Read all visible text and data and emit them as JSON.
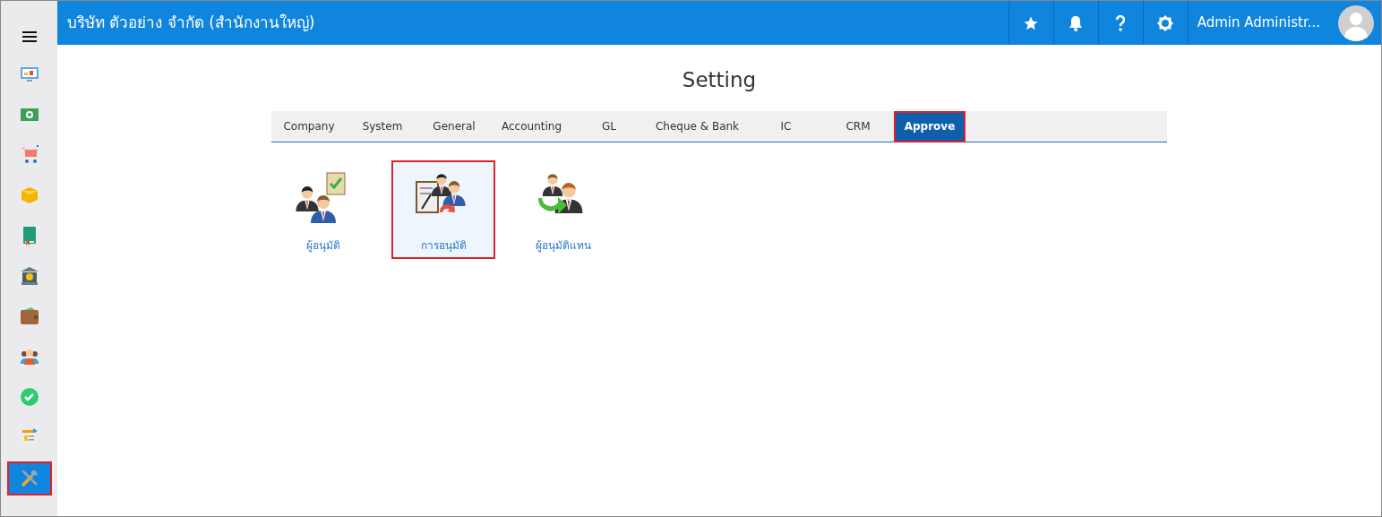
{
  "header": {
    "company": "บริษัท ตัวอย่าง จำกัด (สำนักงานใหญ่)",
    "user": "Admin Administr..."
  },
  "sidebar": {
    "items": [
      {
        "selected": false
      },
      {
        "selected": false
      },
      {
        "selected": false
      },
      {
        "selected": false
      },
      {
        "selected": false
      },
      {
        "selected": false
      },
      {
        "selected": false
      },
      {
        "selected": false
      },
      {
        "selected": false
      },
      {
        "selected": false
      },
      {
        "selected": true
      }
    ]
  },
  "page_title": "Setting",
  "tabs": [
    {
      "label": "Company",
      "selected": false
    },
    {
      "label": "System",
      "selected": false
    },
    {
      "label": "General",
      "selected": false
    },
    {
      "label": "Accounting",
      "selected": false
    },
    {
      "label": "GL",
      "selected": false
    },
    {
      "label": "Cheque & Bank",
      "selected": false
    },
    {
      "label": "IC",
      "selected": false
    },
    {
      "label": "CRM",
      "selected": false
    },
    {
      "label": "Approve",
      "selected": true
    }
  ],
  "settings": [
    {
      "label": "ผู้อนุมัติ",
      "selected": false
    },
    {
      "label": "การอนุมัติ",
      "selected": true
    },
    {
      "label": "ผู้อนุมัติแทน",
      "selected": false
    }
  ]
}
